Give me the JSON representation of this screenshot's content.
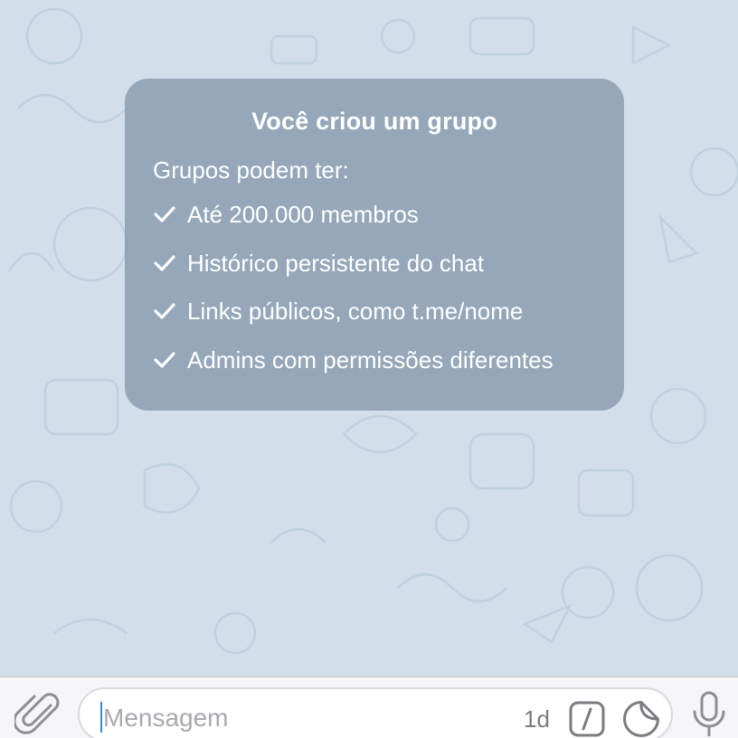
{
  "info_card": {
    "title": "Você criou um grupo",
    "subtitle": "Grupos podem ter:",
    "features": [
      "Até 200.000 membros",
      "Histórico persistente do chat",
      "Links públicos, como t.me/nome",
      "Admins com permissões diferentes"
    ]
  },
  "composer": {
    "placeholder": "Mensagem",
    "timer_label": "1d",
    "icons": {
      "attach": "paperclip-icon",
      "command": "slash-command-icon",
      "sticker": "sticker-icon",
      "voice": "microphone-icon"
    }
  },
  "colors": {
    "wallpaper": "#d2dfea",
    "card": "#70849b",
    "accent": "#3d88d6"
  }
}
